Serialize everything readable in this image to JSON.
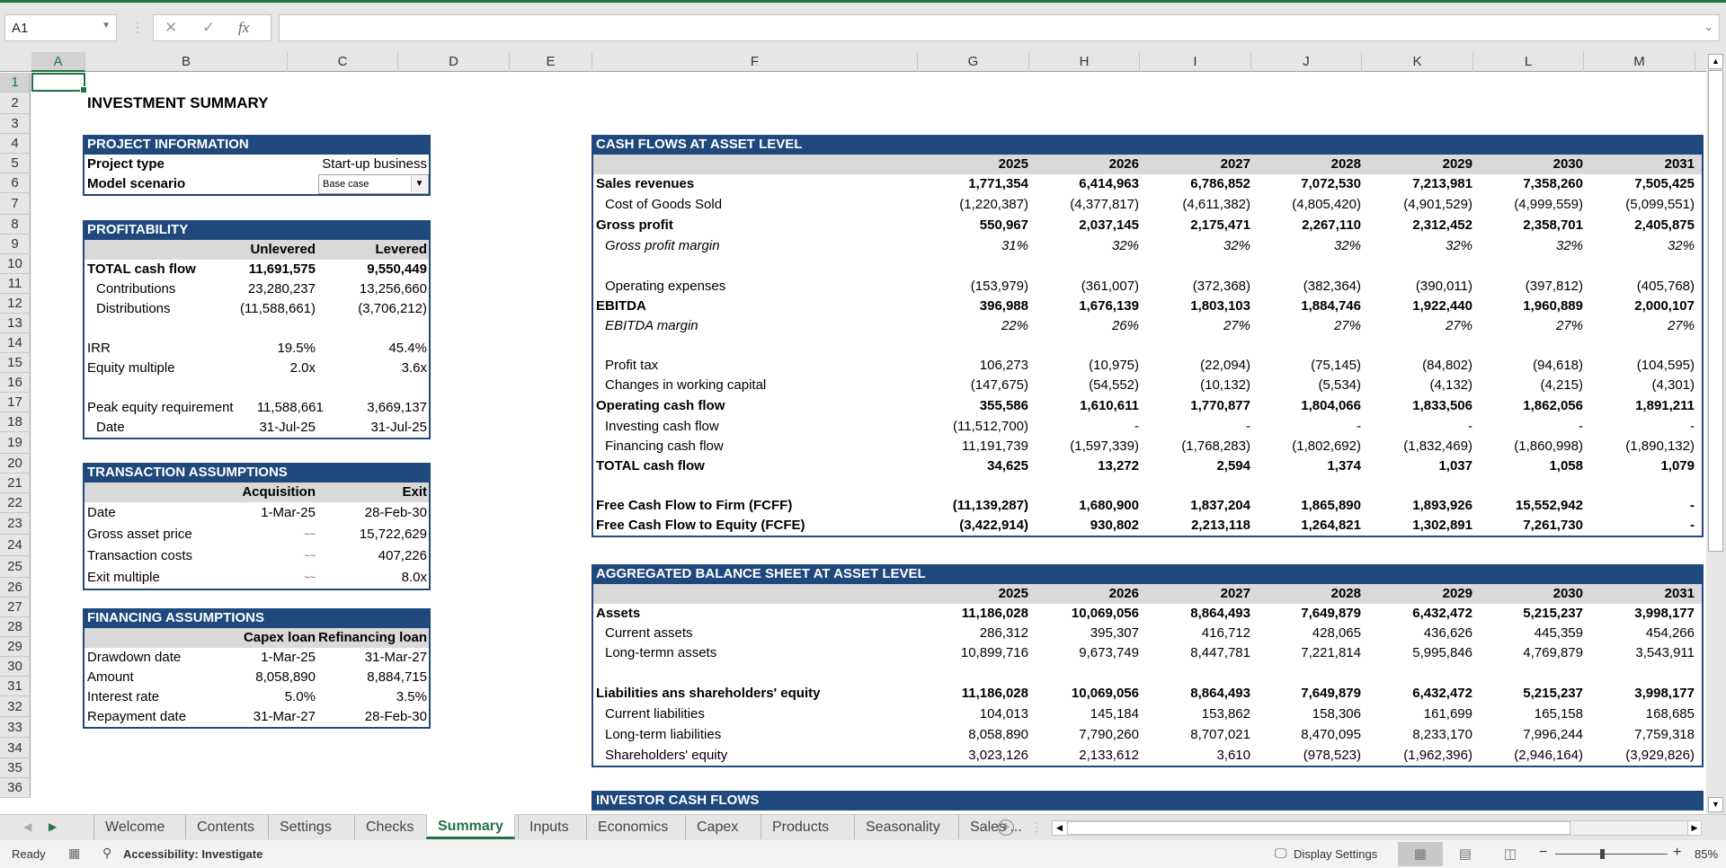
{
  "app": {
    "name_box": "A1",
    "formula_value": "",
    "formula_icons": [
      "cancel-icon",
      "enter-icon",
      "function-icon"
    ]
  },
  "grid": {
    "columns": [
      "A",
      "B",
      "C",
      "D",
      "E",
      "F",
      "G",
      "H",
      "I",
      "J",
      "K",
      "L",
      "M"
    ],
    "rows": [
      "1",
      "2",
      "3",
      "4",
      "5",
      "6",
      "7",
      "8",
      "9",
      "10",
      "11",
      "12",
      "13",
      "14",
      "15",
      "16",
      "17",
      "18",
      "19",
      "20",
      "21",
      "22",
      "23",
      "24",
      "25",
      "26",
      "27",
      "28",
      "29",
      "30",
      "31",
      "32",
      "33",
      "34",
      "35",
      "36"
    ],
    "selected_cell": "A1"
  },
  "sheet": {
    "title": "INVESTMENT SUMMARY",
    "project_info": {
      "header": "PROJECT INFORMATION",
      "project_type_label": "Project type",
      "project_type_value": "Start-up business",
      "scenario_label": "Model scenario",
      "scenario_value": "Base case"
    },
    "profitability": {
      "header": "PROFITABILITY",
      "col1": "Unlevered",
      "col2": "Levered",
      "rows": [
        {
          "label": "TOTAL cash flow",
          "u": "11,691,575",
          "l": "9,550,449",
          "style": "b"
        },
        {
          "label": "Contributions",
          "u": "23,280,237",
          "l": "13,256,660",
          "style": "ind"
        },
        {
          "label": "Distributions",
          "u": "(11,588,661)",
          "l": "(3,706,212)",
          "style": "ind"
        },
        {
          "label": "",
          "u": "",
          "l": "",
          "style": ""
        },
        {
          "label": "IRR",
          "u": "19.5%",
          "l": "45.4%",
          "style": ""
        },
        {
          "label": "Equity multiple",
          "u": "2.0x",
          "l": "3.6x",
          "style": ""
        },
        {
          "label": "",
          "u": "",
          "l": "",
          "style": ""
        },
        {
          "label": "Peak equity requirement",
          "u": "11,588,661",
          "l": "3,669,137",
          "style": ""
        },
        {
          "label": "Date",
          "u": "31-Jul-25",
          "l": "31-Jul-25",
          "style": "ind"
        }
      ]
    },
    "transaction": {
      "header": "TRANSACTION ASSUMPTIONS",
      "col1": "Acquisition",
      "col2": "Exit",
      "rows": [
        {
          "label": "Date",
          "a": "1-Mar-25",
          "e": "28-Feb-30"
        },
        {
          "label": "Gross asset price",
          "a": "~~",
          "e": "15,722,629"
        },
        {
          "label": "Transaction costs",
          "a": "~~",
          "e": "407,226"
        },
        {
          "label": "Exit multiple",
          "a": "~~",
          "e": "8.0x"
        }
      ]
    },
    "financing": {
      "header": "FINANCING ASSUMPTIONS",
      "col1": "Capex loan",
      "col2": "Refinancing loan",
      "rows": [
        {
          "label": "Drawdown date",
          "a": "1-Mar-25",
          "b": "31-Mar-27"
        },
        {
          "label": "Amount",
          "a": "8,058,890",
          "b": "8,884,715"
        },
        {
          "label": "Interest rate",
          "a": "5.0%",
          "b": "3.5%"
        },
        {
          "label": "Repayment date",
          "a": "31-Mar-27",
          "b": "28-Feb-30"
        }
      ]
    },
    "cash_flows": {
      "header": "CASH FLOWS AT ASSET LEVEL",
      "years": [
        "2025",
        "2026",
        "2027",
        "2028",
        "2029",
        "2030",
        "2031"
      ],
      "rows": [
        {
          "label": "Sales revenues",
          "style": "b",
          "values": [
            "1,771,354",
            "6,414,963",
            "6,786,852",
            "7,072,530",
            "7,213,981",
            "7,358,260",
            "7,505,425"
          ]
        },
        {
          "label": "Cost of Goods Sold",
          "style": "ind",
          "values": [
            "(1,220,387)",
            "(4,377,817)",
            "(4,611,382)",
            "(4,805,420)",
            "(4,901,529)",
            "(4,999,559)",
            "(5,099,551)"
          ]
        },
        {
          "label": "Gross profit",
          "style": "b",
          "values": [
            "550,967",
            "2,037,145",
            "2,175,471",
            "2,267,110",
            "2,312,452",
            "2,358,701",
            "2,405,875"
          ]
        },
        {
          "label": "Gross profit margin",
          "style": "ind i",
          "values": [
            "31%",
            "32%",
            "32%",
            "32%",
            "32%",
            "32%",
            "32%"
          ]
        },
        {
          "label": "",
          "style": "",
          "values": [
            "",
            "",
            "",
            "",
            "",
            "",
            ""
          ]
        },
        {
          "label": "Operating expenses",
          "style": "ind",
          "values": [
            "(153,979)",
            "(361,007)",
            "(372,368)",
            "(382,364)",
            "(390,011)",
            "(397,812)",
            "(405,768)"
          ]
        },
        {
          "label": "EBITDA",
          "style": "b",
          "values": [
            "396,988",
            "1,676,139",
            "1,803,103",
            "1,884,746",
            "1,922,440",
            "1,960,889",
            "2,000,107"
          ]
        },
        {
          "label": "EBITDA margin",
          "style": "ind i",
          "values": [
            "22%",
            "26%",
            "27%",
            "27%",
            "27%",
            "27%",
            "27%"
          ]
        },
        {
          "label": "",
          "style": "",
          "values": [
            "",
            "",
            "",
            "",
            "",
            "",
            ""
          ]
        },
        {
          "label": "Profit tax",
          "style": "ind",
          "values": [
            "106,273",
            "(10,975)",
            "(22,094)",
            "(75,145)",
            "(84,802)",
            "(94,618)",
            "(104,595)"
          ]
        },
        {
          "label": "Changes in working capital",
          "style": "ind",
          "values": [
            "(147,675)",
            "(54,552)",
            "(10,132)",
            "(5,534)",
            "(4,132)",
            "(4,215)",
            "(4,301)"
          ]
        },
        {
          "label": "Operating cash flow",
          "style": "b",
          "values": [
            "355,586",
            "1,610,611",
            "1,770,877",
            "1,804,066",
            "1,833,506",
            "1,862,056",
            "1,891,211"
          ]
        },
        {
          "label": "Investing cash flow",
          "style": "ind",
          "values": [
            "(11,512,700)",
            "-",
            "-",
            "-",
            "-",
            "-",
            "-"
          ]
        },
        {
          "label": "Financing cash flow",
          "style": "ind",
          "values": [
            "11,191,739",
            "(1,597,339)",
            "(1,768,283)",
            "(1,802,692)",
            "(1,832,469)",
            "(1,860,998)",
            "(1,890,132)"
          ]
        },
        {
          "label": "TOTAL cash flow",
          "style": "b",
          "values": [
            "34,625",
            "13,272",
            "2,594",
            "1,374",
            "1,037",
            "1,058",
            "1,079"
          ]
        },
        {
          "label": "",
          "style": "",
          "values": [
            "",
            "",
            "",
            "",
            "",
            "",
            ""
          ]
        },
        {
          "label": "Free Cash Flow to Firm (FCFF)",
          "style": "b",
          "values": [
            "(11,139,287)",
            "1,680,900",
            "1,837,204",
            "1,865,890",
            "1,893,926",
            "15,552,942",
            "-"
          ]
        },
        {
          "label": "Free Cash Flow to Equity (FCFE)",
          "style": "b",
          "values": [
            "(3,422,914)",
            "930,802",
            "2,213,118",
            "1,264,821",
            "1,302,891",
            "7,261,730",
            "-"
          ]
        }
      ]
    },
    "balance_sheet": {
      "header": "AGGREGATED BALANCE SHEET AT ASSET LEVEL",
      "years": [
        "2025",
        "2026",
        "2027",
        "2028",
        "2029",
        "2030",
        "2031"
      ],
      "rows": [
        {
          "label": "Assets",
          "style": "b",
          "values": [
            "11,186,028",
            "10,069,056",
            "8,864,493",
            "7,649,879",
            "6,432,472",
            "5,215,237",
            "3,998,177"
          ]
        },
        {
          "label": "Current assets",
          "style": "ind",
          "values": [
            "286,312",
            "395,307",
            "416,712",
            "428,065",
            "436,626",
            "445,359",
            "454,266"
          ]
        },
        {
          "label": "Long-termn assets",
          "style": "ind",
          "values": [
            "10,899,716",
            "9,673,749",
            "8,447,781",
            "7,221,814",
            "5,995,846",
            "4,769,879",
            "3,543,911"
          ]
        },
        {
          "label": "",
          "style": "",
          "values": [
            "",
            "",
            "",
            "",
            "",
            "",
            ""
          ]
        },
        {
          "label": "Liabilities ans shareholders' equity",
          "style": "b",
          "values": [
            "11,186,028",
            "10,069,056",
            "8,864,493",
            "7,649,879",
            "6,432,472",
            "5,215,237",
            "3,998,177"
          ]
        },
        {
          "label": "Current liabilities",
          "style": "ind",
          "values": [
            "104,013",
            "145,184",
            "153,862",
            "158,306",
            "161,699",
            "165,158",
            "168,685"
          ]
        },
        {
          "label": "Long-term liabilities",
          "style": "ind",
          "values": [
            "8,058,890",
            "7,790,260",
            "8,707,021",
            "8,470,095",
            "8,233,170",
            "7,996,244",
            "7,759,318"
          ]
        },
        {
          "label": "Shareholders' equity",
          "style": "ind",
          "values": [
            "3,023,126",
            "2,133,612",
            "3,610",
            "(978,523)",
            "(1,962,396)",
            "(2,946,164)",
            "(3,929,826)"
          ]
        }
      ]
    },
    "investor_cash_flows": {
      "header": "INVESTOR CASH FLOWS"
    }
  },
  "tabs": {
    "items": [
      "Welcome",
      "Contents",
      "Settings",
      "Checks",
      "Summary",
      "Inputs",
      "Economics",
      "Capex",
      "Products",
      "Seasonality",
      "Sales ..."
    ],
    "active": "Summary"
  },
  "status": {
    "ready": "Ready",
    "accessibility": "Accessibility: Investigate",
    "display_settings": "Display Settings",
    "zoom": "85%",
    "zoom_percent": 85
  },
  "colors": {
    "header_blue": "#1f497d",
    "excel_green": "#217346",
    "subheader_gray": "#d9d9d9"
  }
}
